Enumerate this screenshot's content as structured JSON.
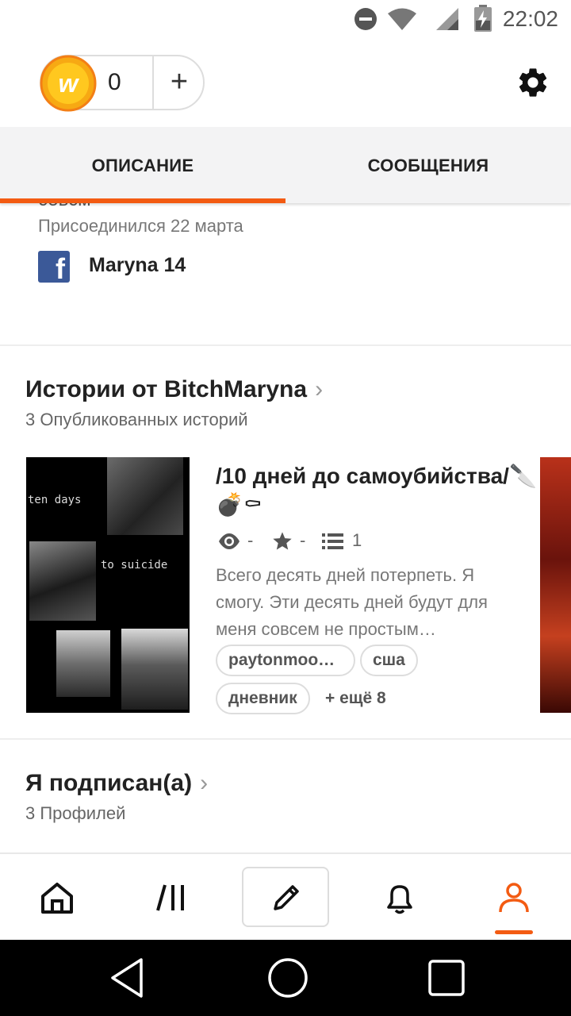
{
  "status_bar": {
    "time": "22:02",
    "icons": [
      "do-not-disturb-icon",
      "wifi-icon",
      "signal-icon",
      "battery-charging-icon"
    ]
  },
  "header": {
    "coin_count": "0",
    "plus_label": "+",
    "coin_icon": "wattpad-coin-icon",
    "settings_icon": "gear-icon"
  },
  "tabs": [
    {
      "label": "ОПИСАНИЕ",
      "active": true
    },
    {
      "label": "СООБЩЕНИЯ",
      "active": false
    }
  ],
  "about": {
    "truncated_text": "совсм",
    "joined": "Присоединился 22 марта",
    "facebook_name": "Maryna 14"
  },
  "stories_section": {
    "title": "Истории от BitchMaryna",
    "subtitle": "3 Опубликованных историй",
    "story": {
      "title": "/10 дней до самоубийства/🔪💣⚰",
      "cover_text_1": "ten days",
      "cover_text_2": "to suicide",
      "views": "-",
      "votes": "-",
      "parts": "1",
      "description": "Всего десять дней потерпеть. Я смогу. Эти десять дней будут для меня совсем не простым…",
      "tags": [
        "paytonmoo…",
        "сша",
        "дневник"
      ],
      "more_tags": "+ ещё 8"
    }
  },
  "following_section": {
    "title": "Я подписан(а)",
    "subtitle": "3 Профилей"
  },
  "bottom_nav": [
    "home-icon",
    "browse-icon",
    "write-icon",
    "notifications-icon",
    "profile-icon"
  ],
  "colors": {
    "accent": "#f35b12",
    "facebook": "#3b5998",
    "tab_bg": "#f3f3f4"
  }
}
